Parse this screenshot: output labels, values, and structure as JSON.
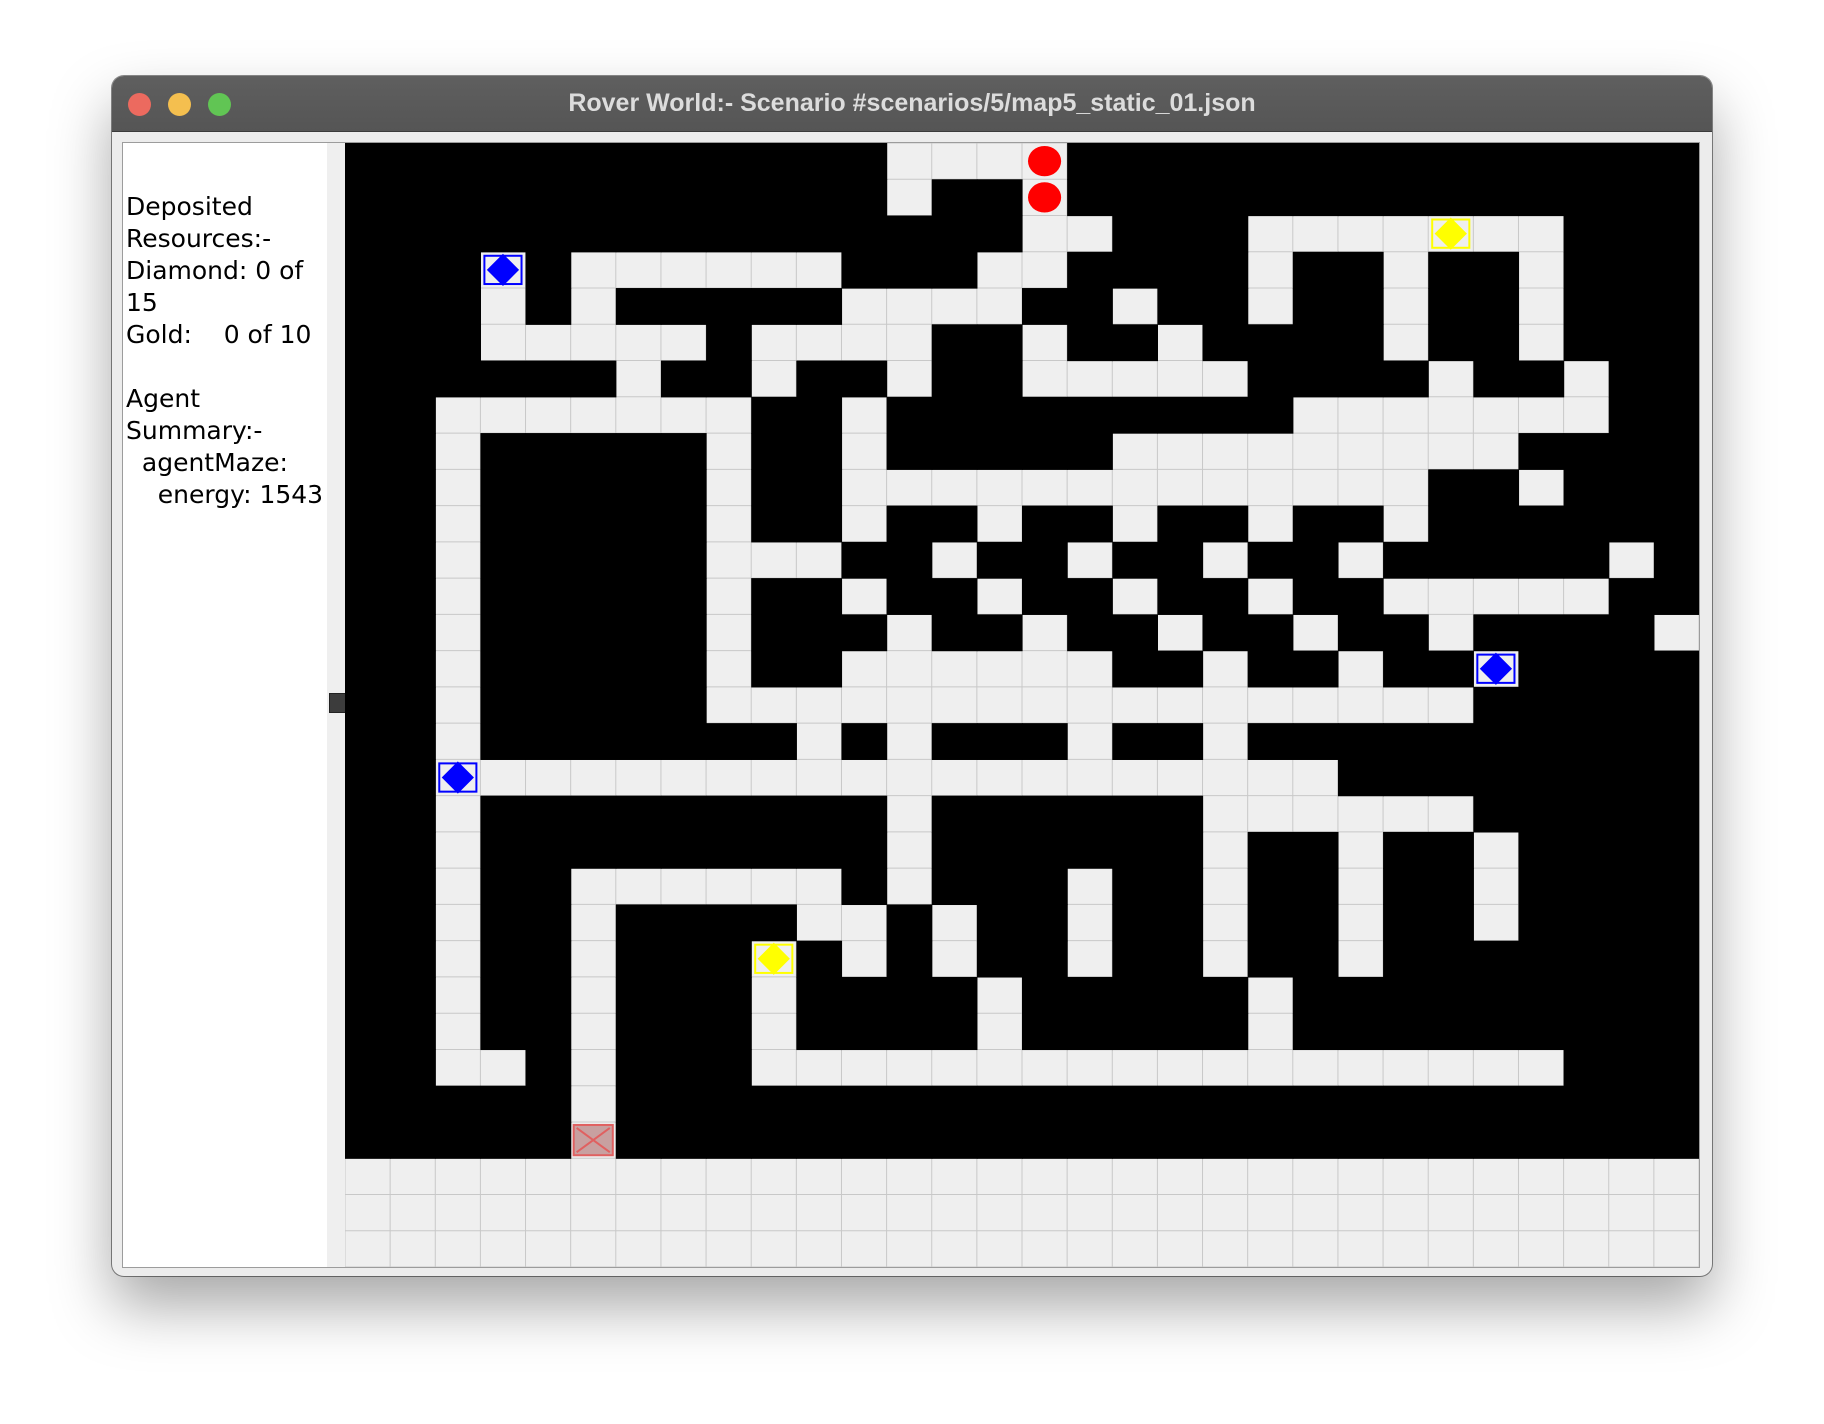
{
  "window": {
    "title": "Rover World:- Scenario #scenarios/5/map5_static_01.json"
  },
  "side_panel": {
    "lines": [
      "Deposited",
      "Resources:-",
      "Diamond: 0 of",
      "15",
      "Gold:    0 of 10",
      "",
      "Agent",
      "Summary:-",
      "  agentMaze:",
      "    energy: 1543"
    ]
  },
  "colors": {
    "floor": "#efefef",
    "wall": "#000000",
    "grid_line": "#c8c8c8",
    "diamond": "#0000ff",
    "gold": "#ffff00",
    "agent": "#ff0000",
    "base_fill": "#c8a0a0",
    "base_border": "#e06060"
  },
  "map": {
    "cols": 30,
    "rows": 31,
    "rows_data": [
      "############+++A##############",
      "############+##A##############",
      "###############++###++++G++###",
      "###D#++++++###++####+##+##+###",
      "###+#+#####++++##+##+##+##+###",
      "###+++++#++++##+##+####+##+###",
      "######+##+##+##+++++####+##+##",
      "##+++++++##+#########+++++++##",
      "##+#####+##+#####+++++++++####",
      "##+#####+##+++++++++++++##+###",
      "##+#####+##+##+##+##+##+######",
      "##+#####+++##+##+##+##+#####+#",
      "##+#####+##+##+##+##+##+++++##",
      "##+#####+###+##+##+##+##+####+",
      "##+#####+##++++++##+##+##D####",
      "##+#####+++++++++++++++++####",
      "##+#######+#+###+##+#########",
      "##D+++++++++++++++++++#######",
      "##+#########+######++++++####",
      "##+#########+######+##+##+###",
      "##+##++++++#+###+##+##+##+###",
      "##+##+####++#+##+##+##+##+###",
      "##+##+###G#+#+##+##+##+######",
      "##+##+###+####+#####+########",
      "##+##+###+####+#####+########",
      "##++#+###++++++++++++++++++##",
      "#####+########################",
      "#####B########################"
    ]
  }
}
